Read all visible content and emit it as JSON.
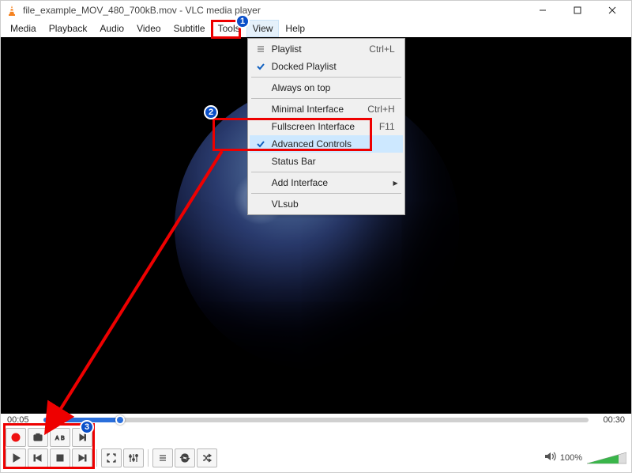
{
  "window": {
    "title": "file_example_MOV_480_700kB.mov - VLC media player"
  },
  "menubar": {
    "items": [
      "Media",
      "Playback",
      "Audio",
      "Video",
      "Subtitle",
      "Tools",
      "View",
      "Help"
    ],
    "active_index": 6
  },
  "dropdown": {
    "items": [
      {
        "label": "Playlist",
        "shortcut": "Ctrl+L",
        "checked": false,
        "icon": "list"
      },
      {
        "label": "Docked Playlist",
        "shortcut": "",
        "checked": true
      },
      {
        "sep": true
      },
      {
        "label": "Always on top",
        "shortcut": "",
        "checked": false
      },
      {
        "sep": true
      },
      {
        "label": "Minimal Interface",
        "shortcut": "Ctrl+H",
        "checked": false
      },
      {
        "label": "Fullscreen Interface",
        "shortcut": "F11",
        "checked": false
      },
      {
        "label": "Advanced Controls",
        "shortcut": "",
        "checked": true,
        "highlight": true
      },
      {
        "label": "Status Bar",
        "shortcut": "",
        "checked": false
      },
      {
        "sep": true
      },
      {
        "label": "Add Interface",
        "shortcut": "",
        "submenu": true
      },
      {
        "sep": true
      },
      {
        "label": "VLsub",
        "shortcut": "",
        "checked": false
      }
    ]
  },
  "playback": {
    "elapsed": "00:05",
    "total": "00:30",
    "progress_pct": 14
  },
  "volume": {
    "pct_label": "100%"
  },
  "annotations": {
    "badges": {
      "one": "1",
      "two": "2",
      "three": "3"
    }
  }
}
